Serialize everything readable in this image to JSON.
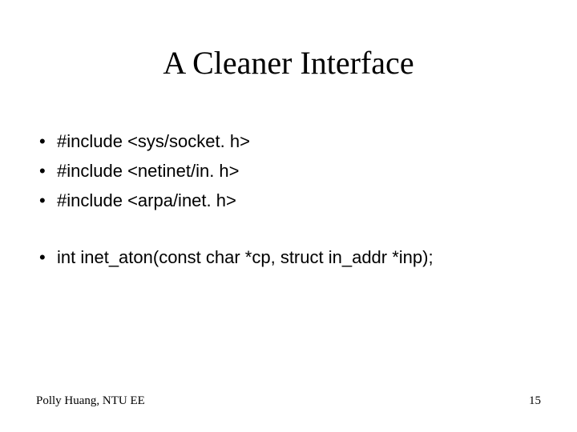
{
  "title": "A Cleaner Interface",
  "bullets_group1": [
    "#include <sys/socket. h>",
    "#include <netinet/in. h>",
    "#include <arpa/inet. h>"
  ],
  "bullets_group2": [
    "int inet_aton(const char *cp, struct in_addr *inp);"
  ],
  "footer": {
    "author": "Polly Huang, NTU EE",
    "page": "15"
  }
}
